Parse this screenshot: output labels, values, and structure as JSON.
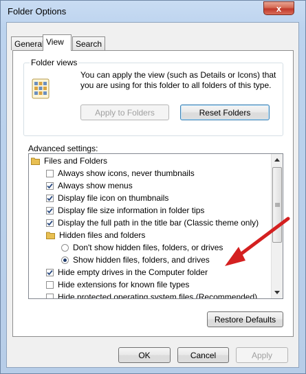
{
  "window": {
    "title": "Folder Options",
    "close_glyph": "x"
  },
  "tabs": [
    {
      "label": "General",
      "active": false
    },
    {
      "label": "View",
      "active": true
    },
    {
      "label": "Search",
      "active": false
    }
  ],
  "folder_views": {
    "label": "Folder views",
    "description": "You can apply the view (such as Details or Icons) that you are using for this folder to all folders of this type.",
    "apply_button": "Apply to Folders",
    "reset_button": "Reset Folders"
  },
  "advanced": {
    "label": "Advanced settings:",
    "items": [
      {
        "type": "folder",
        "label": "Files and Folders"
      },
      {
        "type": "checkbox",
        "checked": false,
        "label": "Always show icons, never thumbnails"
      },
      {
        "type": "checkbox",
        "checked": true,
        "label": "Always show menus"
      },
      {
        "type": "checkbox",
        "checked": true,
        "label": "Display file icon on thumbnails"
      },
      {
        "type": "checkbox",
        "checked": true,
        "label": "Display file size information in folder tips"
      },
      {
        "type": "checkbox",
        "checked": true,
        "label": "Display the full path in the title bar (Classic theme only)"
      },
      {
        "type": "folder",
        "label": "Hidden files and folders"
      },
      {
        "type": "radio",
        "checked": false,
        "label": "Don't show hidden files, folders, or drives"
      },
      {
        "type": "radio",
        "checked": true,
        "label": "Show hidden files, folders, and drives"
      },
      {
        "type": "checkbox",
        "checked": true,
        "label": "Hide empty drives in the Computer folder"
      },
      {
        "type": "checkbox",
        "checked": false,
        "label": "Hide extensions for known file types"
      },
      {
        "type": "checkbox",
        "checked": false,
        "label": "Hide protected operating system files (Recommended)"
      }
    ]
  },
  "buttons": {
    "restore_defaults": "Restore Defaults",
    "ok": "OK",
    "cancel": "Cancel",
    "apply": "Apply"
  },
  "colors": {
    "annotation_arrow": "#d42020",
    "check_mark": "#2a4a80"
  }
}
